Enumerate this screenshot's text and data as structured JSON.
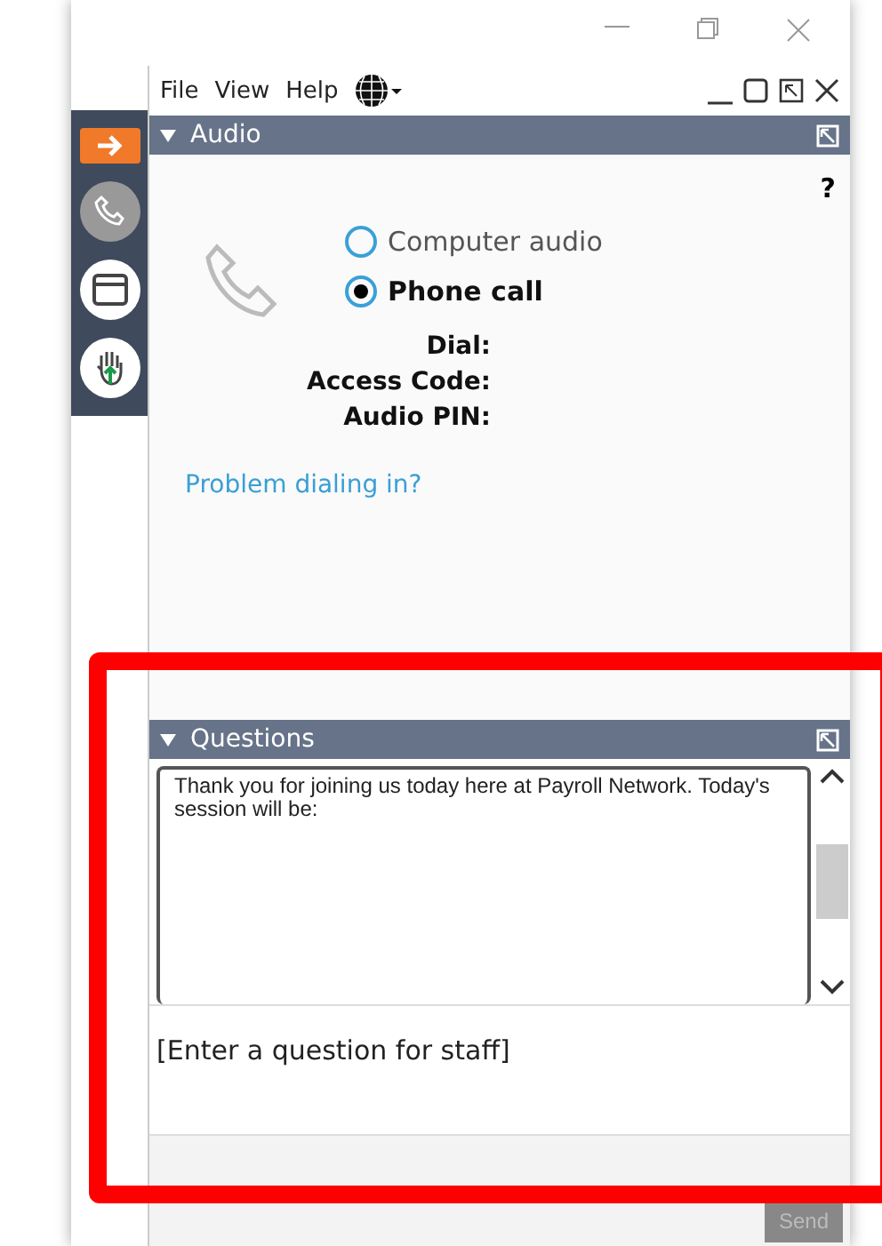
{
  "menu": [
    "File",
    "View",
    "Help"
  ],
  "sidebar": [
    {
      "kind": "arrow",
      "selected": true
    },
    {
      "kind": "phone",
      "selected": false
    },
    {
      "kind": "window",
      "selected": false
    },
    {
      "kind": "hand",
      "selected": false
    }
  ],
  "audio": {
    "title": "Audio",
    "expanded": true,
    "help": "?",
    "options": [
      {
        "label": "Computer audio",
        "selected": false
      },
      {
        "label": "Phone call",
        "selected": true
      }
    ],
    "fields": [
      "Dial:",
      "Access Code:",
      "Audio PIN:"
    ],
    "link": "Problem dialing in?"
  },
  "questions": {
    "title": "Questions",
    "expanded": true,
    "log": "Thank you for joining us today here at Payroll Network.  Today's session will be:",
    "placeholder": "[Enter a question for staff]",
    "send": {
      "label": "Send",
      "disabled": true
    }
  }
}
